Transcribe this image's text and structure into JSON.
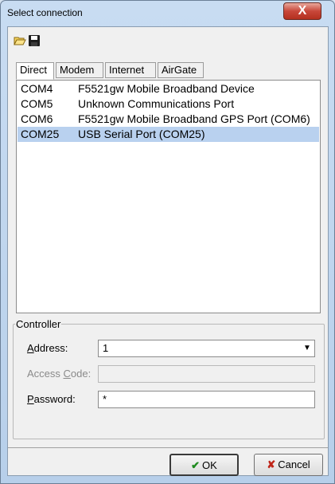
{
  "window": {
    "title": "Select connection",
    "close_glyph": "X"
  },
  "toolbar": {
    "icons": [
      "open-folder-icon",
      "save-disk-icon"
    ]
  },
  "tabs": [
    {
      "label": "Direct",
      "active": true
    },
    {
      "label": "Modem",
      "active": false
    },
    {
      "label": "Internet",
      "active": false
    },
    {
      "label": "AirGate",
      "active": false
    }
  ],
  "ports": [
    {
      "port": "COM4",
      "description": "F5521gw Mobile Broadband Device",
      "selected": false
    },
    {
      "port": "COM5",
      "description": "Unknown Communications Port",
      "selected": false
    },
    {
      "port": "COM6",
      "description": "F5521gw Mobile Broadband GPS Port (COM6)",
      "selected": false
    },
    {
      "port": "COM25",
      "description": "USB Serial Port (COM25)",
      "selected": true
    }
  ],
  "controller": {
    "group_label": "Controller",
    "address_label_accel": "A",
    "address_label_rest": "ddress:",
    "address_value": "1",
    "access_code_label_pre": "Access ",
    "access_code_label_accel": "C",
    "access_code_label_rest": "ode:",
    "access_code_value": "",
    "password_label_accel": "P",
    "password_label_rest": "assword:",
    "password_value": "*"
  },
  "buttons": {
    "ok_label": "OK",
    "cancel_label": "Cancel"
  },
  "colors": {
    "selection": "#b9d1ef",
    "ok_check": "#1e8a1e",
    "cancel_cross": "#c0261a",
    "close_button": "#c8473a"
  }
}
